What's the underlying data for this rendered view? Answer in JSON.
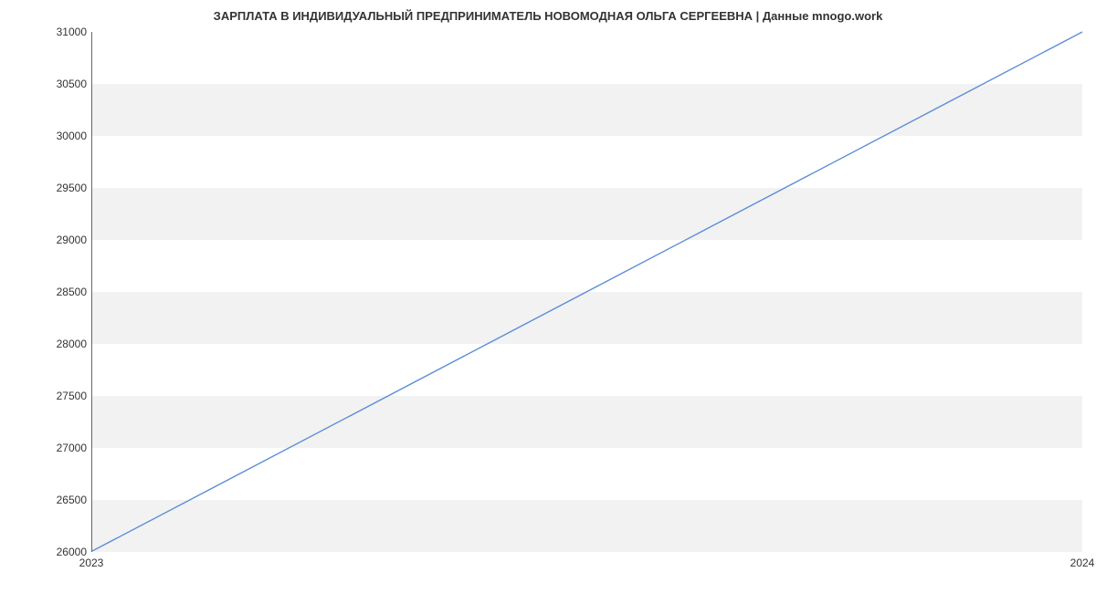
{
  "chart_data": {
    "type": "line",
    "title": "ЗАРПЛАТА В ИНДИВИДУАЛЬНЫЙ ПРЕДПРИНИМАТЕЛЬ НОВОМОДНАЯ ОЛЬГА СЕРГЕЕВНА | Данные mnogo.work",
    "x": [
      2023,
      2024
    ],
    "values": [
      26000,
      31000
    ],
    "xlabel": "",
    "ylabel": "",
    "xticks": [
      "2023",
      "2024"
    ],
    "yticks": [
      "26000",
      "26500",
      "27000",
      "27500",
      "28000",
      "28500",
      "29000",
      "29500",
      "30000",
      "30500",
      "31000"
    ],
    "xlim": [
      2023,
      2024
    ],
    "ylim": [
      26000,
      31000
    ],
    "line_color": "#5b8fd6",
    "grid_band_color": "#f2f2f2"
  }
}
